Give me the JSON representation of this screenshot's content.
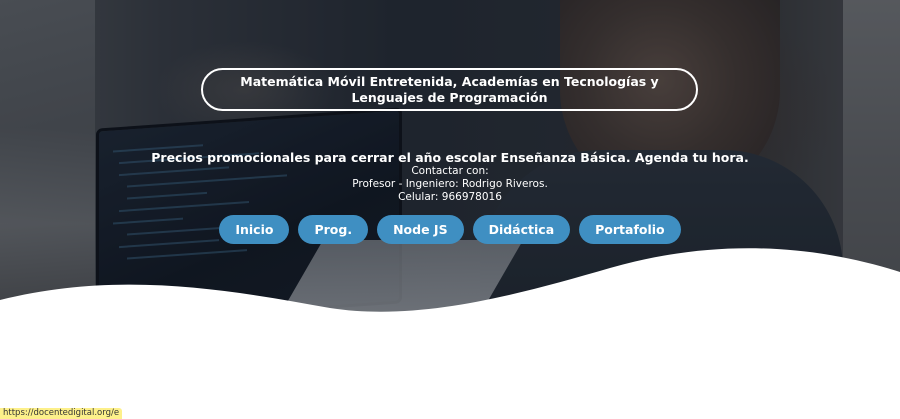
{
  "hero": {
    "title": "Matemática Móvil Entretenida, Academías en Tecnologías y Lenguajes de Programación",
    "promo": "Precios promocionales para cerrar el año escolar Enseñanza Básica. Agenda tu hora.",
    "contact_label": "Contactar con:",
    "contact_person": "Profesor - Ingeniero: Rodrigo Riveros.",
    "contact_phone": "Celular: 966978016"
  },
  "nav": {
    "items": [
      {
        "label": "Inicio"
      },
      {
        "label": "Prog."
      },
      {
        "label": "Node JS"
      },
      {
        "label": "Didáctica"
      },
      {
        "label": "Portafolio"
      }
    ],
    "button_color": "#3f8fc2"
  },
  "status_bar": {
    "url": "https://docentedigital.org/e"
  }
}
